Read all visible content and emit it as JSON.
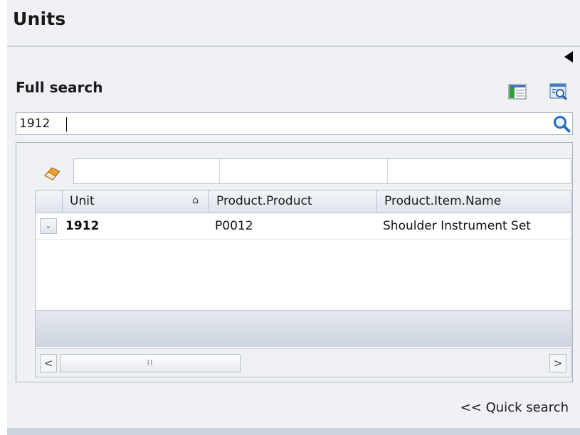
{
  "header": {
    "title": "Units"
  },
  "full_search": {
    "label": "Full search",
    "query_value": "1912",
    "columns_icon": "column-chooser-icon",
    "preview_icon": "search-preview-icon",
    "search_icon": "magnifier-icon"
  },
  "filter": {
    "clear_icon": "eraser-icon"
  },
  "grid": {
    "columns": [
      "Unit",
      "Product.Product",
      "Product.Item.Name"
    ],
    "sort_indicator": "⌂",
    "rows": [
      {
        "unit": "1912",
        "product": "P0012",
        "item_name": "Shoulder Instrument Set"
      }
    ],
    "expand_glyph": "⌄",
    "scroll_left": "<",
    "scroll_right": ">",
    "thumb_grip": "⁞⁞"
  },
  "footer": {
    "quick_search_link": "<< Quick search"
  },
  "colors": {
    "panel_bg": "#eff1f5",
    "border": "#a9b3c2",
    "search_icon": "#2a6bbf"
  }
}
